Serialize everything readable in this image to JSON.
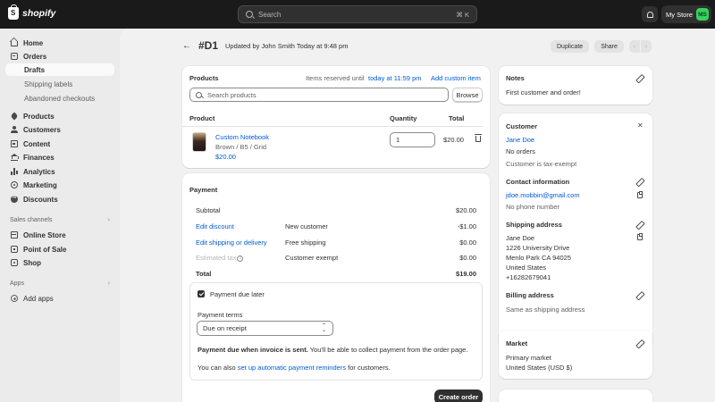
{
  "topbar": {
    "brand": "shopify",
    "search_placeholder": "Search",
    "search_shortcut": "⌘ K",
    "store_name": "My Store",
    "store_initials": "MS"
  },
  "sidebar": {
    "items": [
      {
        "label": "Home"
      },
      {
        "label": "Orders"
      },
      {
        "label": "Drafts"
      },
      {
        "label": "Shipping labels"
      },
      {
        "label": "Abandoned checkouts"
      },
      {
        "label": "Products"
      },
      {
        "label": "Customers"
      },
      {
        "label": "Content"
      },
      {
        "label": "Finances"
      },
      {
        "label": "Analytics"
      },
      {
        "label": "Marketing"
      },
      {
        "label": "Discounts"
      }
    ],
    "sales_channels_label": "Sales channels",
    "channels": [
      {
        "label": "Online Store"
      },
      {
        "label": "Point of Sale"
      },
      {
        "label": "Shop"
      }
    ],
    "apps_label": "Apps",
    "add_apps_label": "Add apps"
  },
  "header": {
    "title": "#D1",
    "subtitle": "Updated by John Smith Today at 9:48 pm",
    "duplicate_label": "Duplicate",
    "share_label": "Share",
    "prev": "‹",
    "next": "›"
  },
  "products": {
    "title": "Products",
    "reserved_text": "Items reserved until",
    "reserved_link": "today at 11:59 pm",
    "add_custom": "Add custom item",
    "search_placeholder": "Search products",
    "browse_label": "Browse",
    "col_product": "Product",
    "col_quantity": "Quantity",
    "col_total": "Total",
    "item": {
      "name": "Custom Notebook",
      "variant": "Brown / B5 / Grid",
      "price": "$20.00",
      "quantity": "1",
      "total": "$20.00"
    }
  },
  "payment": {
    "title": "Payment",
    "subtotal_label": "Subtotal",
    "subtotal_value": "$20.00",
    "discount_label": "Edit discount",
    "discount_desc": "New customer",
    "discount_value": "-$1.00",
    "shipping_label": "Edit shipping or delivery",
    "shipping_desc": "Free shipping",
    "shipping_value": "$0.00",
    "tax_label": "Estimated tax",
    "tax_desc": "Customer exempt",
    "tax_value": "$0.00",
    "total_label": "Total",
    "total_value": "$19.00",
    "due_later_label": "Payment due later",
    "terms_label": "Payment terms",
    "terms_value": "Due on receipt",
    "due_note_bold": "Payment due when invoice is sent.",
    "due_note_rest": " You'll be able to collect payment from the order page.",
    "reminder_pre": "You can also ",
    "reminder_link": "set up automatic payment reminders",
    "reminder_post": " for customers.",
    "create_order_label": "Create order"
  },
  "notes": {
    "title": "Notes",
    "text": "First customer and order!"
  },
  "customer": {
    "title": "Customer",
    "name": "Jane Doe",
    "orders": "No orders",
    "tax": "Customer is tax-exempt",
    "contact_title": "Contact information",
    "email": "jdoe.mobbin@gmail.com",
    "phone": "No phone number",
    "shipping_title": "Shipping address",
    "shipping_lines": [
      "Jane Doe",
      "1226 University Drive",
      "Menlo Park CA 94025",
      "United States",
      "+16282679041"
    ],
    "billing_title": "Billing address",
    "billing_text": "Same as shipping address"
  },
  "market": {
    "title": "Market",
    "name": "Primary market",
    "region": "United States (USD $)"
  }
}
